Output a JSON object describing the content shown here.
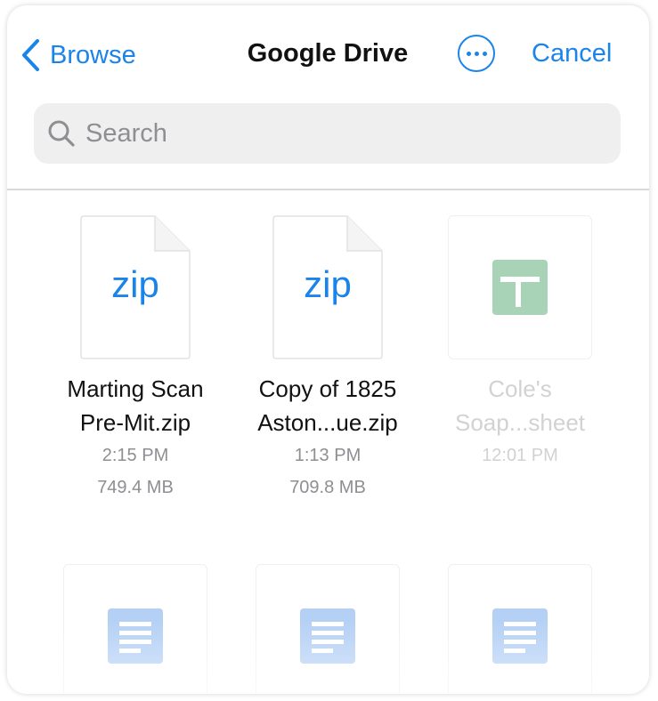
{
  "header": {
    "back_label": "Browse",
    "title": "Google Drive",
    "more_icon": "ellipsis-circle-icon",
    "cancel_label": "Cancel"
  },
  "search": {
    "placeholder": "Search",
    "value": ""
  },
  "colors": {
    "accent": "#1a84ea",
    "sheets_green": "#a9d3b7",
    "docs_blue": "#b4d0f5"
  },
  "files": [
    {
      "name_line1": "Marting Scan",
      "name_line2": "Pre-Mit.zip",
      "time": "2:15 PM",
      "size": "749.4 MB",
      "icon": "zip-file-icon",
      "icon_text": "zip"
    },
    {
      "name_line1": "Copy of 1825",
      "name_line2": "Aston...ue.zip",
      "time": "1:13 PM",
      "size": "709.8 MB",
      "icon": "zip-file-icon",
      "icon_text": "zip"
    },
    {
      "name_line1": "Cole's",
      "name_line2": "Soap...sheet",
      "time": "12:01 PM",
      "size": "",
      "icon": "google-sheets-icon",
      "disabled": true
    },
    {
      "icon": "google-docs-icon",
      "disabled": true
    },
    {
      "icon": "google-docs-icon",
      "disabled": true
    },
    {
      "icon": "google-docs-icon",
      "disabled": true
    }
  ]
}
